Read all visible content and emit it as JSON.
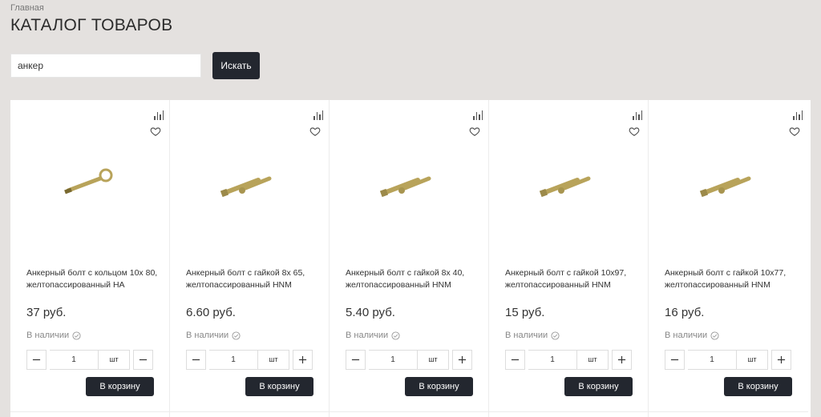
{
  "breadcrumb": "Главная",
  "title": "КАТАЛОГ ТОВАРОВ",
  "search": {
    "value": "анкер",
    "button_label": "Искать"
  },
  "cart_label": "В корзину",
  "products": [
    {
      "name": "Анкерный болт с кольцом 10х 80, желтопассированный HA",
      "price": "37 руб.",
      "availability": "В наличии",
      "quantity": "1",
      "unit": "шт",
      "image": "anchor-hook-bolt",
      "increase_icon": "minus-icon"
    },
    {
      "name": "Анкерный болт с гайкой 8х 65, желтопассированный HNM",
      "price": "6.60 руб.",
      "availability": "В наличии",
      "quantity": "1",
      "unit": "шт",
      "image": "anchor-bolt-nut",
      "increase_icon": "plus-icon"
    },
    {
      "name": "Анкерный болт с гайкой 8х 40, желтопассированный HNM",
      "price": "5.40 руб.",
      "availability": "В наличии",
      "quantity": "1",
      "unit": "шт",
      "image": "anchor-bolt-nut",
      "increase_icon": "plus-icon"
    },
    {
      "name": "Анкерный болт с гайкой 10х97, желтопассированный HNM",
      "price": "15 руб.",
      "availability": "В наличии",
      "quantity": "1",
      "unit": "шт",
      "image": "anchor-bolt-nut",
      "increase_icon": "plus-icon"
    },
    {
      "name": "Анкерный болт с гайкой 10х77, желтопассированный HNM",
      "price": "16 руб.",
      "availability": "В наличии",
      "quantity": "1",
      "unit": "шт",
      "image": "anchor-bolt-nut",
      "increase_icon": "plus-icon"
    }
  ],
  "colors": {
    "background": "#e4e1df",
    "button": "#23272f",
    "card": "#ffffff",
    "bolt": "#b8a35a"
  }
}
